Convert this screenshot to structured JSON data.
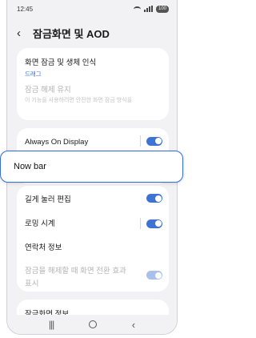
{
  "status_bar": {
    "time": "12:45",
    "battery": "100"
  },
  "header": {
    "title": "잠금화면 및 AOD"
  },
  "lock_section": {
    "items": [
      {
        "label": "화면 잠금 및 생체 인식",
        "sub": "드래그"
      },
      {
        "label": "잠금 해제 유지",
        "sub": "이 기능을 사용하려면 안전한 화면 잠금 방식을"
      }
    ]
  },
  "aod": {
    "label": "Always On Display",
    "enabled": true
  },
  "nowbar": {
    "label": "Now bar"
  },
  "options": {
    "items": [
      {
        "label": "길게 눌러 편집",
        "enabled": true
      },
      {
        "label": "로밍 시계",
        "enabled": true
      },
      {
        "label": "연락처 정보"
      },
      {
        "label": "잠금을 해제할 때 화면 전환 효과",
        "label2": "표시",
        "enabled": true,
        "disabled": true
      }
    ]
  },
  "info": {
    "label": "잠금화면 정보"
  },
  "colors": {
    "accent": "#3e73d6",
    "highlight_border": "#2f6fe0",
    "background": "#f2f2f5"
  }
}
